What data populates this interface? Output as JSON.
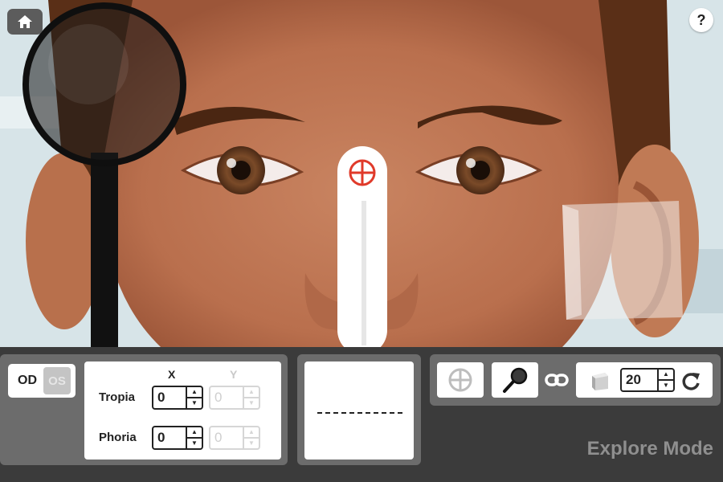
{
  "nav": {
    "home_icon": "home-icon",
    "help_label": "?"
  },
  "eye_toggle": {
    "od_label": "OD",
    "os_label": "OS",
    "selected": "OD"
  },
  "measurements": {
    "col_x": "X",
    "col_y": "Y",
    "tropia": {
      "label": "Tropia",
      "x": "0",
      "y": "0"
    },
    "phoria": {
      "label": "Phoria",
      "x": "0",
      "y": "0"
    }
  },
  "tools": {
    "target_icon": "crosshair-target-icon",
    "occluder_icon": "magnifier-occluder-icon",
    "link_icon": "link-icon",
    "prism_icon": "prism-icon",
    "prism_value": "20",
    "rotate_icon": "rotate-icon"
  },
  "mode_label": "Explore Mode",
  "colors": {
    "panel": "#6c6c6c",
    "background": "#3b3b3b",
    "target_red": "#e03a2a"
  }
}
